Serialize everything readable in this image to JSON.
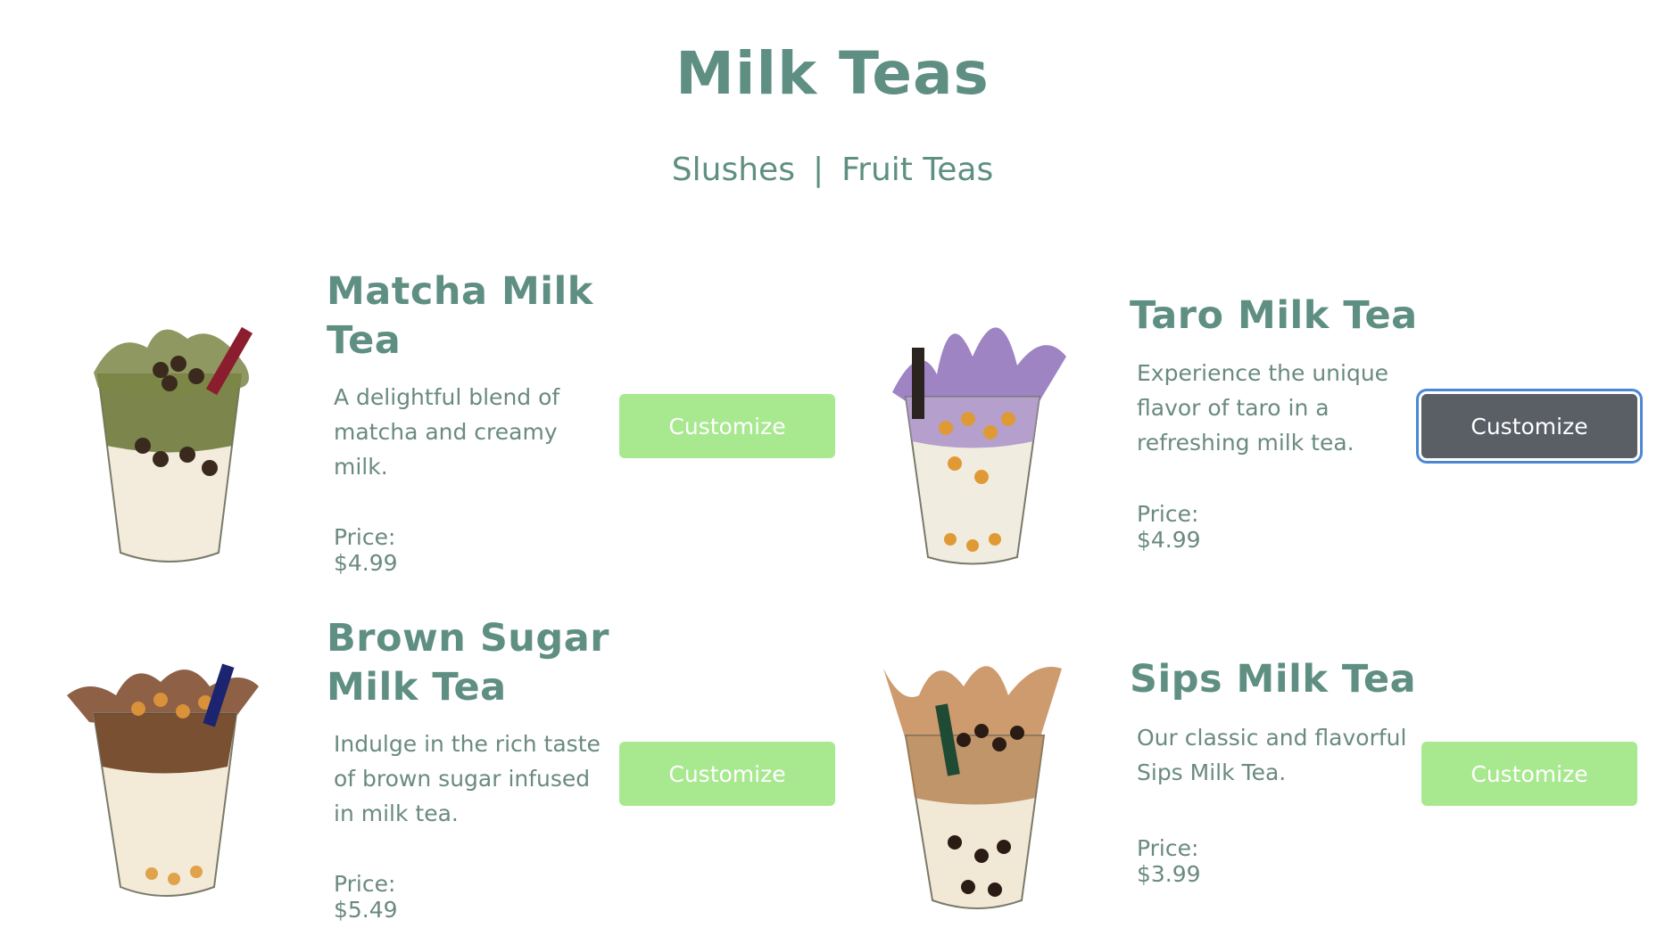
{
  "header": {
    "title": "Milk Teas"
  },
  "nav": {
    "items": [
      "Slushes",
      "Fruit Teas"
    ],
    "separator": "|"
  },
  "products": [
    {
      "name": "Matcha Milk Tea",
      "description": "A delightful blend of matcha and creamy milk.",
      "price": "Price: $4.99",
      "button": "Customize",
      "image_icon": "matcha-boba-cup-icon",
      "cup_color": "#6f7a3c",
      "selected": false
    },
    {
      "name": "Taro Milk Tea",
      "description": "Experience the unique flavor of taro in a refreshing milk tea.",
      "price": "Price: $4.99",
      "button": "Customize",
      "image_icon": "taro-boba-cup-icon",
      "cup_color": "#8d6fb8",
      "selected": true
    },
    {
      "name": "Brown Sugar Milk Tea",
      "description": "Indulge in the rich taste of brown sugar infused in milk tea.",
      "price": "Price: $5.49",
      "button": "Customize",
      "image_icon": "brown-sugar-boba-cup-icon",
      "cup_color": "#6b3f1f",
      "selected": false
    },
    {
      "name": "Sips Milk Tea",
      "description": "Our classic and flavorful Sips Milk Tea.",
      "price": "Price: $3.99",
      "button": "Customize",
      "image_icon": "classic-boba-cup-icon",
      "cup_color": "#b07a45",
      "selected": false
    }
  ],
  "colors": {
    "accent": "#5f8f82",
    "button": "#a8e88f",
    "button_active": "#5a5e65",
    "focus_ring": "#4a88d6"
  }
}
